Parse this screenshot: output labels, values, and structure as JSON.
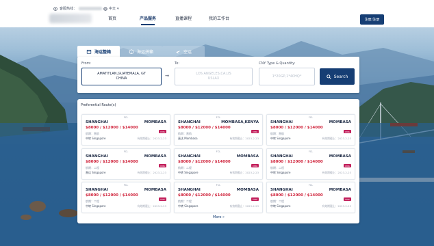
{
  "header": {
    "hotline": "客服热线：",
    "language": "中文",
    "nav": [
      "首页",
      "产品服务",
      "直播课程",
      "我的工作台"
    ],
    "active_nav": 1,
    "register": "注册/注册"
  },
  "tabs": [
    {
      "label": "海运整箱",
      "icon": "calendar-icon"
    },
    {
      "label": "海运拼箱",
      "icon": "box-icon"
    },
    {
      "label": "空运",
      "icon": "plane-icon"
    }
  ],
  "search": {
    "from_label": "From:",
    "from_value": "AMATITLAN,GUATEMALA, GT",
    "from_value2": "CHINA",
    "to_label": "To:",
    "to_placeholder": "LOS ANGELES,CA,US",
    "to_placeholder2": "USLAX",
    "qty_label": "CNY Type & Quantity:",
    "qty_placeholder": "1*20GP,1*40HQ*",
    "button": "Search"
  },
  "routes": {
    "title": "Preferential Route(s)",
    "more": "More »",
    "cards": [
      {
        "tag": "FCL",
        "origin": "SHANGHAI",
        "dest": "MOMBASA",
        "price": "$8000 / $12000 / $14000",
        "line": "航期：直航",
        "via": "中转 Singapore",
        "valid": "有效期截止：2023-2-23",
        "badge": "CMA"
      },
      {
        "tag": "FCL",
        "origin": "SHANGHAI",
        "dest": "MOMBASA,KENYA",
        "price": "$8000 / $12000 / $14000",
        "line": "航期：直航",
        "via": "直达 Mombasa",
        "valid": "有效期截止：2023-2-23",
        "badge": "CMA"
      },
      {
        "tag": "FCL",
        "origin": "SHANGHAI",
        "dest": "MOMBASA",
        "price": "$8000 / $12000 / $14000",
        "line": "航期：直航",
        "via": "中转 Singapore",
        "valid": "有效期截止：2023-2-23",
        "badge": "CMA"
      },
      {
        "tag": "FCL",
        "origin": "SHANGHAI",
        "dest": "MOMBASA",
        "price": "$8000 / $12000 / $14000",
        "line": "航期：二程",
        "via": "直达 Singapore",
        "valid": "有效期截止：2023-2-23",
        "badge": "CMA"
      },
      {
        "tag": "FCL",
        "origin": "SHANGHAI",
        "dest": "MOMBASA",
        "price": "$8000 / $12000 / $14000",
        "line": "航期：二程",
        "via": "中转 Singapore",
        "valid": "有效期截止：2023-2-23",
        "badge": "CMA"
      },
      {
        "tag": "FCL",
        "origin": "SHANGHAI",
        "dest": "MOMBASA",
        "price": "$8000 / $12000 / $14000",
        "line": "航期：二程",
        "via": "中转 Singapore",
        "valid": "有效期截止：2023-2-23",
        "badge": "CMA"
      },
      {
        "tag": "FCL",
        "origin": "SHANGHAI",
        "dest": "MOMBASA",
        "price": "$8000 / $12000 / $14000",
        "line": "航期：二程",
        "via": "中转 Singapore",
        "valid": "有效期截止：2023-2-23",
        "badge": "CMA"
      },
      {
        "tag": "FCL",
        "origin": "SHANGHAI",
        "dest": "MOMBASA",
        "price": "$8000 / $12000 / $14000",
        "line": "航期：二程",
        "via": "中转 Singapore",
        "valid": "有效期截止：2023-2-23",
        "badge": "CMA"
      },
      {
        "tag": "FCL",
        "origin": "SHANGHAI",
        "dest": "MOMBASA",
        "price": "$8000 / $12000 / $14000",
        "line": "航期：二程",
        "via": "中转 Singapore",
        "valid": "有效期截止：2023-2-23",
        "badge": "CMA"
      }
    ]
  },
  "colors": {
    "brand": "#163e74",
    "price": "#d0243c",
    "badge": "#c21f5b"
  }
}
